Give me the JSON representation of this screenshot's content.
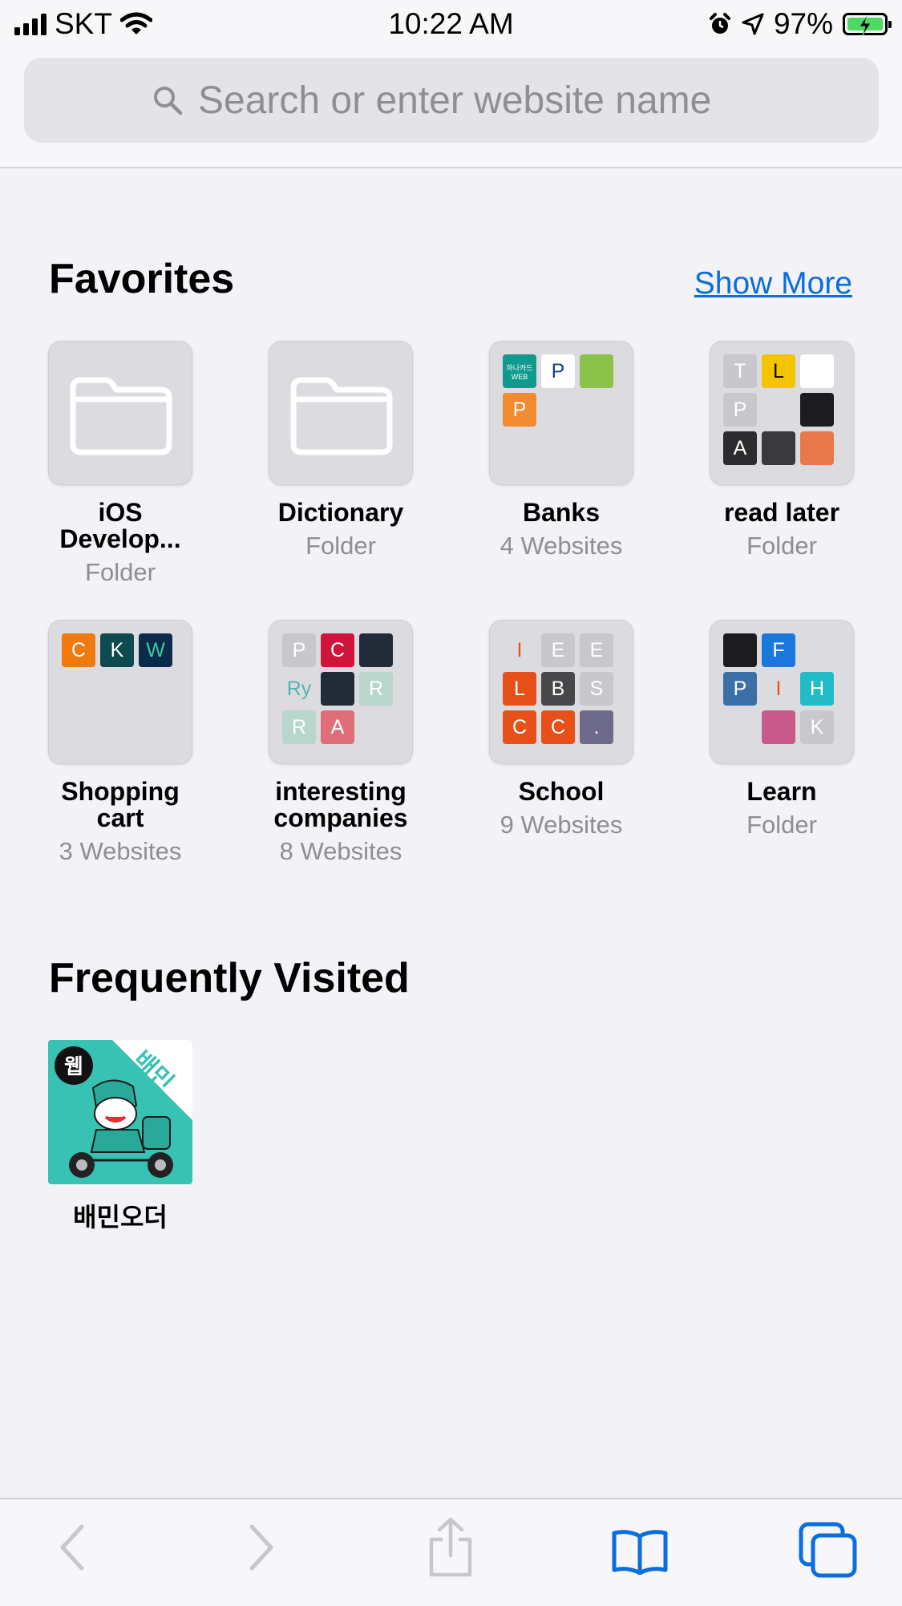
{
  "status_bar": {
    "carrier": "SKT",
    "time": "10:22 AM",
    "battery_percent": "97%"
  },
  "search": {
    "placeholder": "Search or enter website name"
  },
  "favorites": {
    "title": "Favorites",
    "show_more": "Show More",
    "items": [
      {
        "title_line1": "iOS",
        "title_line2": "Develop...",
        "subtitle": "Folder",
        "icon": "folder-icon"
      },
      {
        "title_line1": "Dictionary",
        "subtitle": "Folder",
        "icon": "folder-icon"
      },
      {
        "title_line1": "Banks",
        "subtitle": "4 Websites",
        "minis": [
          {
            "letter": "하나카드 WEB",
            "bg": "#0f9a8e"
          },
          {
            "letter": "P",
            "bg": "#ffffff",
            "fg": "#1a3f9e"
          },
          {
            "letter": "",
            "bg": "#8bc34a"
          },
          {
            "letter": "P",
            "bg": "#f28a30"
          }
        ]
      },
      {
        "title_line1": "read later",
        "subtitle": "Folder",
        "minis": [
          {
            "letter": "T",
            "bg": "#c7c7cc"
          },
          {
            "letter": "L",
            "bg": "#f5c400",
            "fg": "#000000"
          },
          {
            "letter": "",
            "bg": "#ffffff",
            "fg": "#12806b"
          },
          {
            "letter": "P",
            "bg": "#c7c7cc"
          },
          {
            "letter": "",
            "bg": "#dcdce0",
            "fg": "#7a7a7a"
          },
          {
            "letter": "",
            "bg": "#1c1c1e",
            "fg": "#f5c400"
          },
          {
            "letter": "A",
            "bg": "#2c2c2e"
          },
          {
            "letter": "",
            "bg": "#3a3a3c"
          },
          {
            "letter": "",
            "bg": "#e8784a"
          }
        ]
      },
      {
        "title_line1": "Shopping",
        "title_line2": "cart",
        "subtitle": "3 Websites",
        "minis": [
          {
            "letter": "C",
            "bg": "#f07a10"
          },
          {
            "letter": "K",
            "bg": "#0e4a4e"
          },
          {
            "letter": "W",
            "bg": "#0c2b4a",
            "fg": "#3ac8a0"
          }
        ]
      },
      {
        "title_line1": "interesting",
        "title_line2": "companies",
        "subtitle": "8 Websites",
        "minis": [
          {
            "letter": "P",
            "bg": "#c7c7cc"
          },
          {
            "letter": "C",
            "bg": "#d0143c"
          },
          {
            "letter": "",
            "bg": "#222c38"
          },
          {
            "letter": "Ry",
            "bg": "#dcdce0",
            "fg": "#52b6b0"
          },
          {
            "letter": "",
            "bg": "#222c38"
          },
          {
            "letter": "R",
            "bg": "#b9d6cc"
          },
          {
            "letter": "R",
            "bg": "#b9d6cc"
          },
          {
            "letter": "A",
            "bg": "#e06e78"
          }
        ]
      },
      {
        "title_line1": "School",
        "subtitle": "9 Websites",
        "minis": [
          {
            "letter": "I",
            "bg": "#dcdce0",
            "fg": "#e8501a"
          },
          {
            "letter": "E",
            "bg": "#c7c7cc"
          },
          {
            "letter": "E",
            "bg": "#c7c7cc"
          },
          {
            "letter": "L",
            "bg": "#e8501a"
          },
          {
            "letter": "B",
            "bg": "#48484a"
          },
          {
            "letter": "S",
            "bg": "#c7c7cc"
          },
          {
            "letter": "C",
            "bg": "#e8501a"
          },
          {
            "letter": "C",
            "bg": "#e8501a"
          },
          {
            "letter": ".",
            "bg": "#6e6a8c"
          }
        ]
      },
      {
        "title_line1": "Learn",
        "subtitle": "Folder",
        "minis": [
          {
            "letter": "",
            "bg": "#1c1c1e",
            "fg": "#f5c400"
          },
          {
            "letter": "F",
            "bg": "#1a78dc"
          },
          {
            "letter": "",
            "bg": "#dcdce0",
            "fg": "#f07a10"
          },
          {
            "letter": "P",
            "bg": "#3a6fa8"
          },
          {
            "letter": "I",
            "bg": "#dcdce0",
            "fg": "#e8501a"
          },
          {
            "letter": "H",
            "bg": "#22bcc8"
          },
          {
            "letter": "",
            "bg": "#dcdce0"
          },
          {
            "letter": "",
            "bg": "#c85a8a"
          },
          {
            "letter": "K",
            "bg": "#c7c7cc"
          }
        ]
      }
    ]
  },
  "frequently_visited": {
    "title": "Frequently Visited",
    "items": [
      {
        "title": "배민오더",
        "badge": "웹",
        "corner": "배민"
      }
    ]
  },
  "colors": {
    "accent": "#0a6ee0",
    "background": "#f2f2f7",
    "toolbar_disabled": "#c7c7cc"
  }
}
